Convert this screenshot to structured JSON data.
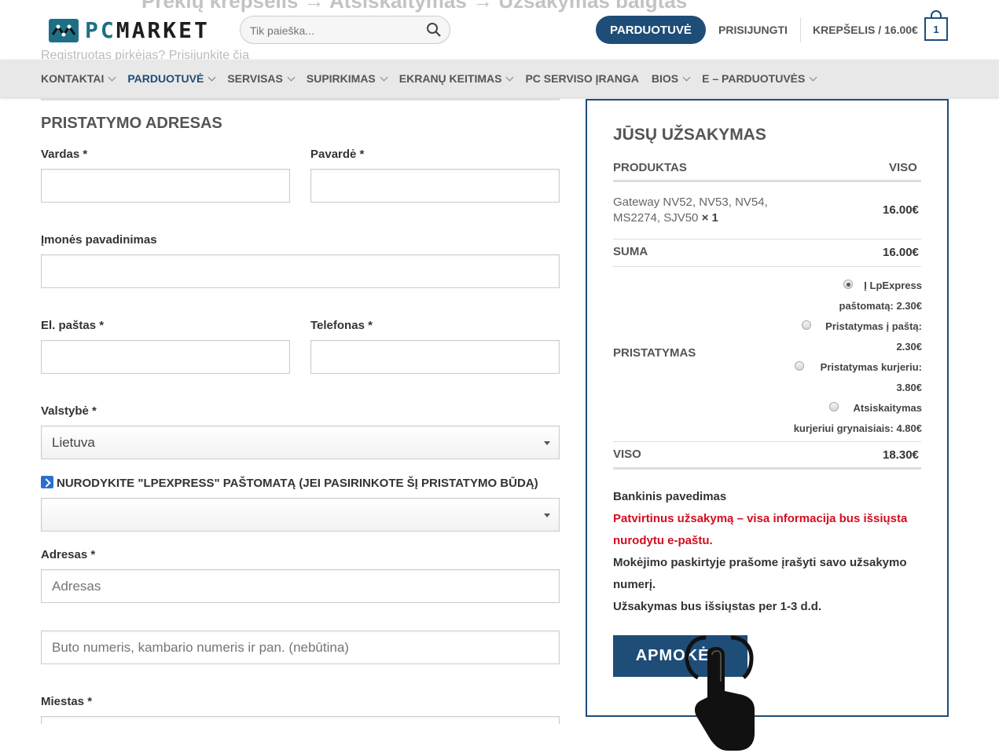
{
  "header": {
    "logo": {
      "pc": "PC",
      "market": "MARKET"
    },
    "top_cut_text": "Prekių krepšelis → Atsiskaitymas → Užsakymas baigtas",
    "search": {
      "placeholder": "Tik paieška..."
    },
    "shop_button": "PARDUOTUVĖ",
    "login": "PRISIJUNGTI",
    "cart_label": "KREPŠELIS / 16.00€",
    "cart_count": "1",
    "ghost_text": "Registruotas pirkėjas? Prisijunkite čia"
  },
  "nav": {
    "items": [
      {
        "label": "KONTAKTAI"
      },
      {
        "label": "PARDUOTUVĖ"
      },
      {
        "label": "SERVISAS"
      },
      {
        "label": "SUPIRKIMAS"
      },
      {
        "label": "EKRANŲ KEITIMAS"
      },
      {
        "label": "PC SERVISO ĮRANGA"
      },
      {
        "label": "BIOS"
      },
      {
        "label": "E – PARDUOTUVĖS"
      }
    ]
  },
  "form": {
    "title": "PRISTATYMO ADRESAS",
    "first_name_label": "Vardas *",
    "last_name_label": "Pavardė *",
    "company_label": "Įmonės pavadinimas",
    "email_label": "El. paštas *",
    "phone_label": "Telefonas *",
    "country_label": "Valstybė *",
    "country_value": "Lietuva",
    "lpexpress_label": "NURODYKITE \"LPEXPRESS\" PAŠTOMATĄ (JEI PASIRINKOTE ŠĮ PRISTATYMO BŪDĄ)",
    "address_label": "Adresas *",
    "address_placeholder": "Adresas",
    "apartment_placeholder": "Buto numeris, kambario numeris ir pan. (nebūtina)",
    "city_label": "Miestas *"
  },
  "order": {
    "title": "JŪSŲ UŽSAKYMAS",
    "col_product": "PRODUKTAS",
    "col_total": "VISO",
    "product_line1": "Gateway NV52, NV53, NV54,",
    "product_line2": "MS2274, SJV50",
    "product_qty": "× 1",
    "product_price": "16.00€",
    "subtotal_label": "SUMA",
    "subtotal_value": "16.00€",
    "shipping_label": "PRISTATYMAS",
    "shipping_options": [
      {
        "line1": "Į LpExpress",
        "line2": "paštomatą: 2.30€",
        "selected": true
      },
      {
        "line1": "Pristatymas į paštą:",
        "line2": "2.30€",
        "selected": false
      },
      {
        "line1": "Pristatymas kurjeriu:",
        "line2": "3.80€",
        "selected": false
      },
      {
        "line1": "Atsiskaitymas",
        "line2": "kurjeriui grynaisiais: 4.80€",
        "selected": false
      }
    ],
    "total_label": "VISO",
    "total_value": "18.30€",
    "payment_method": "Bankinis pavedimas",
    "payment_red1": "Patvirtinus užsakymą – visa informacija bus išsiųsta",
    "payment_red2": "nurodytu e-paštu.",
    "payment_note1": "Mokėjimo paskirtyje prašome įrašyti savo užsakymo",
    "payment_note2": "numerį.",
    "payment_note3": "Užsakymas bus išsiųstas per 1-3 d.d.",
    "pay_button": "APMOKĖTI"
  },
  "colors": {
    "brand": "#1e4d78",
    "accent_red": "#d20e1f",
    "logo_teal": "#1d6f86"
  }
}
